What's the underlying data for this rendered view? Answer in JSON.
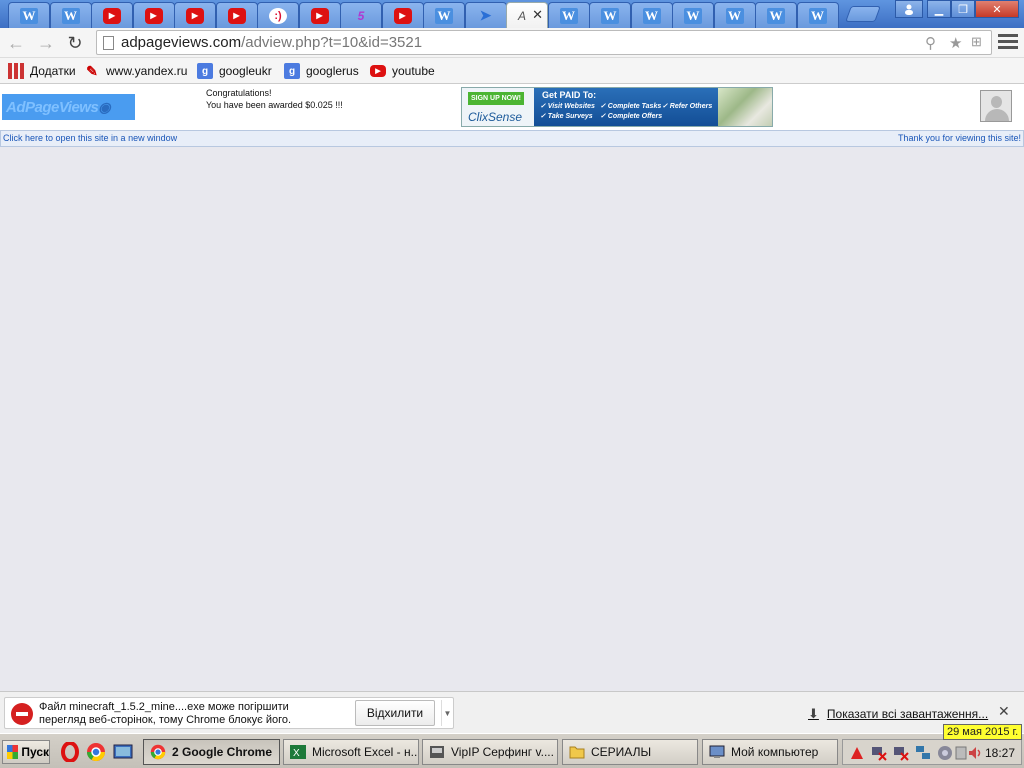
{
  "tabs": [
    {
      "icon": "w",
      "letter": "W"
    },
    {
      "icon": "w",
      "letter": "W"
    },
    {
      "icon": "yt",
      "letter": "▶"
    },
    {
      "icon": "yt",
      "letter": "▶"
    },
    {
      "icon": "yt",
      "letter": "▶"
    },
    {
      "icon": "yt",
      "letter": "▶"
    },
    {
      "icon": "ok",
      "letter": ":)"
    },
    {
      "icon": "yt",
      "letter": "▶"
    },
    {
      "icon": "five",
      "letter": "5"
    },
    {
      "icon": "yt",
      "letter": "▶"
    },
    {
      "icon": "w",
      "letter": "W"
    },
    {
      "icon": "bird",
      "letter": "➤"
    },
    {
      "icon": "active",
      "letter": "A"
    },
    {
      "icon": "w",
      "letter": "W"
    },
    {
      "icon": "w",
      "letter": "W"
    },
    {
      "icon": "w",
      "letter": "W"
    },
    {
      "icon": "w",
      "letter": "W"
    },
    {
      "icon": "w",
      "letter": "W"
    },
    {
      "icon": "w",
      "letter": "W"
    },
    {
      "icon": "w",
      "letter": "W"
    }
  ],
  "toolbar": {
    "url_host": "adpageviews.com",
    "url_path": "/adview.php?t=10&id=3521"
  },
  "bookmarks": [
    {
      "label": "Додатки",
      "icon": "apps-icon"
    },
    {
      "label": "www.yandex.ru",
      "icon": "yandex-icon"
    },
    {
      "label": "googleukr",
      "icon": "google-icon"
    },
    {
      "label": "googlerus",
      "icon": "google-icon"
    },
    {
      "label": "youtube",
      "icon": "youtube-icon"
    }
  ],
  "adheader": {
    "logo_text": "AdPageViews",
    "congrats_line1": "Congratulations!",
    "congrats_line2": "You have been awarded $0.025 !!!",
    "banner": {
      "signup": "SIGN UP NOW!",
      "brand": "ClixSense",
      "headline": "Get PAID To:",
      "features": [
        "✓ Visit Websites",
        "✓ Complete Tasks",
        "✓ Refer Others",
        "✓ Take Surveys",
        "✓ Complete Offers"
      ]
    }
  },
  "linkbar": {
    "open_link": "Click here to open this site in a new window",
    "thanks": "Thank you for viewing this site!"
  },
  "download": {
    "line1": "Файл minecraft_1.5.2_mine....exe може погіршити",
    "line2": "перегляд веб-сторінок, тому Chrome блокує його.",
    "discard_label": "Відхилити",
    "show_all": "Показати всі завантаження..."
  },
  "taskbar": {
    "start_label": "Пуск",
    "buttons": [
      {
        "label": "2 Google Chrome"
      },
      {
        "label": "Microsoft Excel - н..."
      },
      {
        "label": "VipIP Серфинг v...."
      },
      {
        "label": "СЕРИАЛЫ"
      },
      {
        "label": "Мой компьютер"
      }
    ],
    "clock": "18:27",
    "date_tooltip": "29 мая 2015 г."
  }
}
